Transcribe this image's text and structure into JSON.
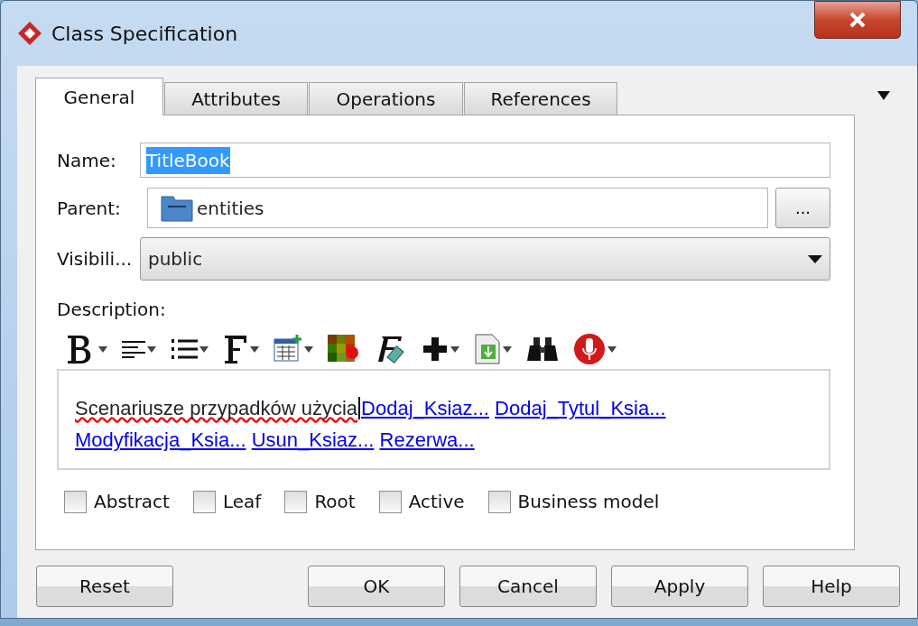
{
  "window": {
    "title": "Class Specification"
  },
  "tabs": [
    {
      "label": "General",
      "selected": true
    },
    {
      "label": "Attributes",
      "selected": false
    },
    {
      "label": "Operations",
      "selected": false
    },
    {
      "label": "References",
      "selected": false
    }
  ],
  "fields": {
    "name": {
      "label": "Name:",
      "value": "TitleBook",
      "text_selected": true
    },
    "parent": {
      "label": "Parent:",
      "value": "entities",
      "button": "..."
    },
    "visibility": {
      "label": "Visibili...",
      "value": "public"
    }
  },
  "description": {
    "label": "Description:",
    "text": "Scenariusze przypadków użycia",
    "links": [
      "Dodaj_Ksiaz...",
      "Dodaj_Tytul_Ksia...",
      "Modyfikacja_Ksia...",
      "Usun_Ksiaz...",
      "Rezerwa..."
    ]
  },
  "checkboxes": [
    {
      "label": "Abstract",
      "checked": false
    },
    {
      "label": "Leaf",
      "checked": false
    },
    {
      "label": "Root",
      "checked": false
    },
    {
      "label": "Active",
      "checked": false
    },
    {
      "label": "Business model",
      "checked": false
    }
  ],
  "buttons": [
    "Reset",
    "OK",
    "Cancel",
    "Apply",
    "Help"
  ]
}
